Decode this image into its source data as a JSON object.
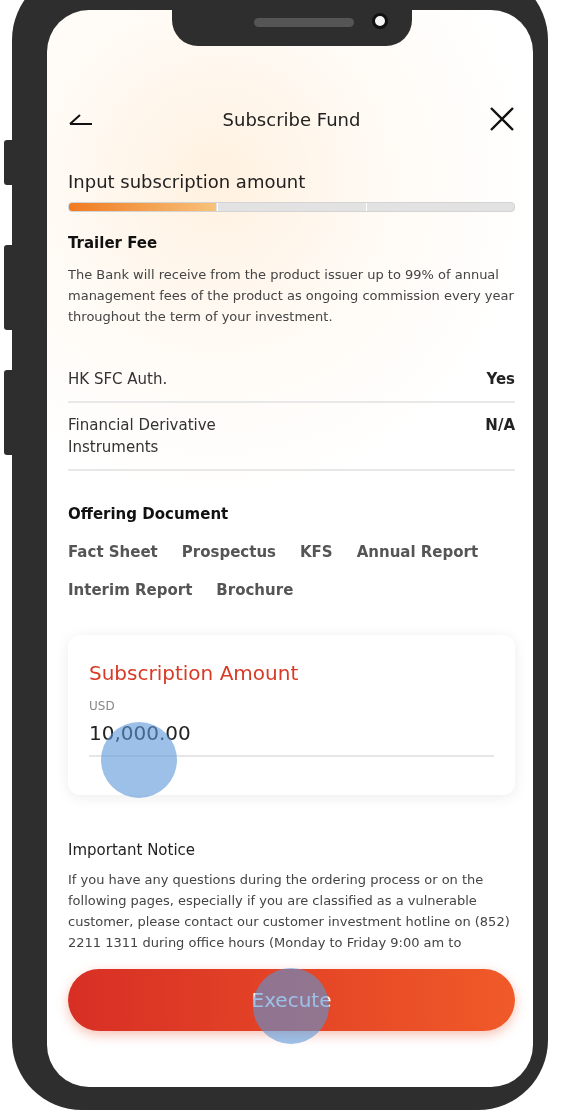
{
  "header": {
    "title": "Subscribe Fund"
  },
  "step": {
    "title": "Input subscription amount",
    "level": 0.33
  },
  "trailer_fee": {
    "title": "Trailer Fee",
    "text": "The Bank will receive from the product issuer up to 99% of annual management fees of the product as ongoing commission every year throughout the term of your investment."
  },
  "details": [
    {
      "label": "HK SFC Auth.",
      "value": "Yes"
    },
    {
      "label": "Financial Derivative Instruments",
      "value": "N/A"
    }
  ],
  "offering_document": {
    "title": "Offering Document",
    "links": [
      "Fact Sheet",
      "Prospectus",
      "KFS",
      "Annual Report",
      "Interim Report",
      "Brochure"
    ]
  },
  "amount_card": {
    "title": "Subscription Amount",
    "currency": "USD",
    "value": "10,000.00"
  },
  "notice": {
    "title": "Important Notice",
    "text": "If you have any questions during the ordering process or on the following pages, especially if you are classified as a vulnerable customer, please contact our customer investment hotline on (852) 2211 1311 during office hours (Monday to Friday 9:00 am to"
  },
  "execute_button": "Execute"
}
